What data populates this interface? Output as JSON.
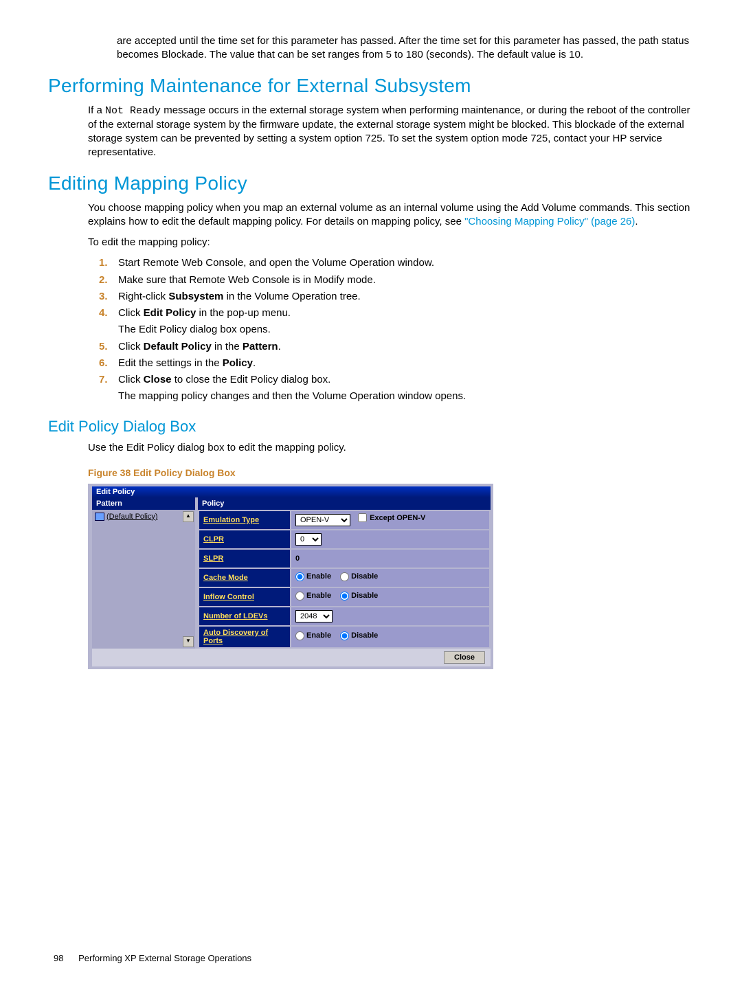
{
  "intro_continuation": "are accepted until the time set for this parameter has passed. After the time set for this parameter has passed, the path status becomes Blockade. The value that can be set ranges from 5 to 180 (seconds). The default value is 10.",
  "sec1_title": "Performing Maintenance for External Subsystem",
  "sec1_p_pre": "If a ",
  "sec1_code": "Not Ready",
  "sec1_p_post": " message occurs in the external storage system when performing maintenance, or during the reboot of the controller of the external storage system by the firmware update, the external storage system might be blocked. This blockade of the external storage system can be prevented by setting a system option 725. To set the system option mode 725, contact your HP service representative.",
  "sec2_title": "Editing Mapping Policy",
  "sec2_p_pre": "You choose mapping policy when you map an external volume as an internal volume using the Add Volume commands. This section explains how to edit the default mapping policy. For details on mapping policy, see ",
  "sec2_link": "\"Choosing Mapping Policy\" (page 26)",
  "sec2_intro2": "To edit the mapping policy:",
  "steps": {
    "s1": "Start Remote Web Console, and open the Volume Operation window.",
    "s2": "Make sure that Remote Web Console is in Modify mode.",
    "s3_pre": "Right-click ",
    "s3_b": "Subsystem",
    "s3_post": " in the Volume Operation tree.",
    "s4_pre": "Click ",
    "s4_b": "Edit Policy",
    "s4_post": " in the pop-up menu.",
    "s4_sub": "The Edit Policy dialog box opens.",
    "s5_pre": "Click ",
    "s5_b1": "Default Policy",
    "s5_mid": " in the ",
    "s5_b2": "Pattern",
    "s5_post": ".",
    "s6_pre": "Edit the settings in the ",
    "s6_b": "Policy",
    "s6_post": ".",
    "s7_pre": "Click ",
    "s7_b": "Close",
    "s7_post": " to close the Edit Policy dialog box.",
    "s7_sub": "The mapping policy changes and then the Volume Operation window opens."
  },
  "sec3_title": "Edit Policy Dialog Box",
  "sec3_p": "Use the Edit Policy dialog box to edit the mapping policy.",
  "figure_caption": "Figure 38 Edit Policy Dialog Box",
  "dialog": {
    "title": "Edit Policy",
    "pattern_header": "Pattern",
    "policy_header": "Policy",
    "pattern_item": "(Default Policy)",
    "rows": {
      "emulation": "Emulation Type",
      "clpr": "CLPR",
      "slpr": "SLPR",
      "cache": "Cache Mode",
      "inflow": "Inflow Control",
      "ldevs": "Number of LDEVs",
      "autod": "Auto Discovery of Ports"
    },
    "emulation_value": "OPEN-V",
    "except_label": "Except OPEN-V",
    "clpr_value": "0",
    "slpr_value": "0",
    "ldevs_value": "2048",
    "enable": "Enable",
    "disable": "Disable",
    "close": "Close"
  },
  "footer": {
    "page": "98",
    "chapter": "Performing XP External Storage Operations"
  }
}
